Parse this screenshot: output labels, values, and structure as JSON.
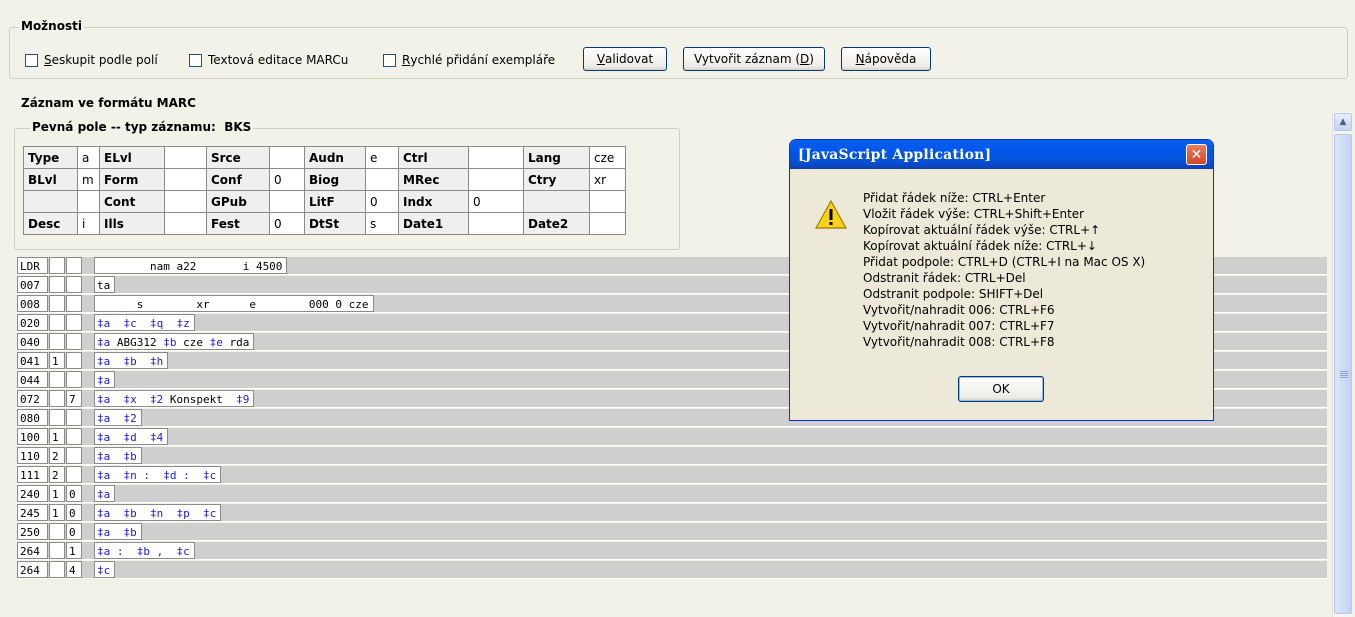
{
  "options": {
    "legend": "Možnosti",
    "checkboxes": [
      {
        "label_u": "S",
        "label_rest": "eskupit podle polí"
      },
      {
        "label_u": "",
        "label_rest": "Textová editace MARCu"
      },
      {
        "label_u": "R",
        "label_rest": "ychlé přidání exempláře"
      }
    ],
    "buttons": {
      "validate_u": "V",
      "validate_rest": "alidovat",
      "create_pre": "Vytvořit záznam (",
      "create_u": "D",
      "create_post": ")",
      "help_u": "N",
      "help_rest": "ápověda"
    }
  },
  "marc_section": {
    "legend": "Záznam ve formátu MARC"
  },
  "fixed_fields": {
    "legend_label": "Pevná pole -- typ záznamu:",
    "legend_value": "BKS",
    "rows": [
      [
        [
          "Type",
          "a"
        ],
        [
          "ELvl",
          ""
        ],
        [
          "Srce",
          ""
        ],
        [
          "Audn",
          "e"
        ],
        [
          "Ctrl",
          ""
        ],
        [
          "Lang",
          "cze"
        ]
      ],
      [
        [
          "BLvl",
          "m"
        ],
        [
          "Form",
          ""
        ],
        [
          "Conf",
          "0"
        ],
        [
          "Biog",
          ""
        ],
        [
          "MRec",
          ""
        ],
        [
          "Ctry",
          "xr"
        ]
      ],
      [
        [
          "",
          ""
        ],
        [
          "Cont",
          ""
        ],
        [
          "GPub",
          ""
        ],
        [
          "LitF",
          "0"
        ],
        [
          "Indx",
          "0"
        ],
        [
          "",
          ""
        ]
      ],
      [
        [
          "Desc",
          "i"
        ],
        [
          "Ills",
          ""
        ],
        [
          "Fest",
          "0"
        ],
        [
          "DtSt",
          "s"
        ],
        [
          "Date1",
          ""
        ],
        [
          "Date2",
          ""
        ]
      ]
    ]
  },
  "marc_rows": [
    {
      "tag": "LDR",
      "i1": "",
      "i2": "",
      "data": [
        {
          "t": "        nam a22       i 4500",
          "s": false
        }
      ]
    },
    {
      "tag": "007",
      "i1": "",
      "i2": "",
      "data": [
        {
          "t": "ta",
          "s": false
        }
      ]
    },
    {
      "tag": "008",
      "i1": "",
      "i2": "",
      "data": [
        {
          "t": "      s        xr      e        000 0 cze",
          "s": false
        }
      ]
    },
    {
      "tag": "020",
      "i1": "",
      "i2": "",
      "data": [
        {
          "t": "‡a  ‡c  ‡q  ‡z",
          "s": true
        }
      ]
    },
    {
      "tag": "040",
      "i1": "",
      "i2": "",
      "data": [
        {
          "t": "‡a",
          "s": true
        },
        {
          "t": "ABG312 ",
          "s": false
        },
        {
          "t": "‡b",
          "s": true
        },
        {
          "t": "cze ",
          "s": false
        },
        {
          "t": "‡e",
          "s": true
        },
        {
          "t": "rda",
          "s": false
        }
      ]
    },
    {
      "tag": "041",
      "i1": "1",
      "i2": "",
      "data": [
        {
          "t": "‡a  ‡b  ‡h",
          "s": true
        }
      ]
    },
    {
      "tag": "044",
      "i1": "",
      "i2": "",
      "data": [
        {
          "t": "‡a",
          "s": true
        }
      ]
    },
    {
      "tag": "072",
      "i1": "",
      "i2": "7",
      "data": [
        {
          "t": "‡a  ‡x  ‡2",
          "s": true
        },
        {
          "t": "Konspekt  ",
          "s": false
        },
        {
          "t": "‡9",
          "s": true
        }
      ]
    },
    {
      "tag": "080",
      "i1": "",
      "i2": "",
      "data": [
        {
          "t": "‡a  ‡2",
          "s": true
        }
      ]
    },
    {
      "tag": "100",
      "i1": "1",
      "i2": "",
      "data": [
        {
          "t": "‡a  ‡d  ‡4",
          "s": true
        }
      ]
    },
    {
      "tag": "110",
      "i1": "2",
      "i2": "",
      "data": [
        {
          "t": "‡a  ‡b",
          "s": true
        }
      ]
    },
    {
      "tag": "111",
      "i1": "2",
      "i2": "",
      "data": [
        {
          "t": "‡a  ‡n :  ‡d :  ‡c",
          "s": true
        }
      ]
    },
    {
      "tag": "240",
      "i1": "1",
      "i2": "0",
      "data": [
        {
          "t": "‡a",
          "s": true
        }
      ]
    },
    {
      "tag": "245",
      "i1": "1",
      "i2": "0",
      "data": [
        {
          "t": "‡a  ‡b  ‡n  ‡p  ‡c",
          "s": true
        }
      ]
    },
    {
      "tag": "250",
      "i1": "",
      "i2": "0",
      "data": [
        {
          "t": "‡a  ‡b",
          "s": true
        }
      ]
    },
    {
      "tag": "264",
      "i1": "",
      "i2": "1",
      "data": [
        {
          "t": "‡a :  ‡b ,  ‡c",
          "s": true
        }
      ]
    },
    {
      "tag": "264",
      "i1": "",
      "i2": "4",
      "data": [
        {
          "t": "‡c",
          "s": true
        }
      ]
    }
  ],
  "dialog": {
    "title": "[JavaScript Application]",
    "close_glyph": "✕",
    "lines": [
      "Přidat řádek níže: CTRL+Enter",
      "Vložit řádek výše: CTRL+Shift+Enter",
      "Kopírovat aktuální řádek výše: CTRL+↑",
      "Kopírovat aktuální řádek níže: CTRL+↓",
      "Přidat podpole: CTRL+D (CTRL+I na Mac OS X)",
      "Odstranit řádek: CTRL+Del",
      "Odstranit podpole: SHIFT+Del",
      "Vytvořit/nahradit 006: CTRL+F6",
      "Vytvořit/nahradit 007: CTRL+F7",
      "Vytvořit/nahradit 008: CTRL+F8"
    ],
    "ok_label": "OK",
    "icon": "warning-icon"
  },
  "scrollbar": {
    "up_glyph": "▲"
  }
}
